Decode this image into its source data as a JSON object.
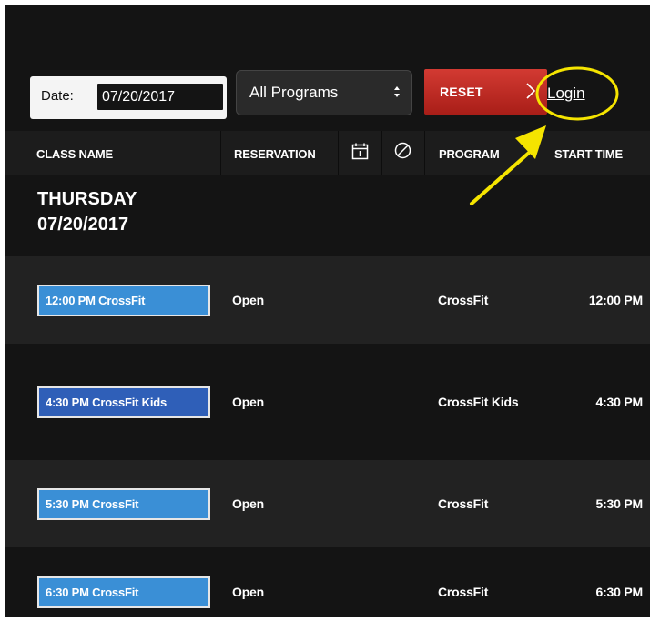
{
  "toolbar": {
    "date_label": "Date:",
    "date_value": "07/20/2017",
    "program_selected": "All Programs",
    "reset_label": "RESET",
    "login_label": "Login"
  },
  "table": {
    "columns": [
      "CLASS NAME",
      "RESERVATION",
      "PROGRAM",
      "START TIME"
    ],
    "day_heading": {
      "weekday": "THURSDAY",
      "date": "07/20/2017"
    },
    "rows": [
      {
        "class_name": "12:00 PM CrossFit",
        "reservation": "Open",
        "program": "CrossFit",
        "start_time": "12:00 PM",
        "button_color": "#3a8fd6"
      },
      {
        "class_name": "4:30 PM CrossFit Kids",
        "reservation": "Open",
        "program": "CrossFit Kids",
        "start_time": "4:30 PM",
        "button_color": "#2f5fb8"
      },
      {
        "class_name": "5:30 PM CrossFit",
        "reservation": "Open",
        "program": "CrossFit",
        "start_time": "5:30 PM",
        "button_color": "#3a8fd6"
      },
      {
        "class_name": "6:30 PM CrossFit",
        "reservation": "Open",
        "program": "CrossFit",
        "start_time": "6:30 PM",
        "button_color": "#3a8fd6"
      }
    ]
  },
  "icons": {
    "calendar": "calendar-icon",
    "prohibit": "prohibit-icon",
    "reset_chevron": "chevron-right-icon",
    "select_arrows": "select-arrows-icon"
  },
  "colors": {
    "background": "#141414",
    "reset_button": "#c22b24",
    "highlight": "#f5e400"
  }
}
